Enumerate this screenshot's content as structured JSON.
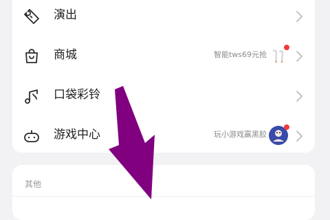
{
  "menu": {
    "items": [
      {
        "label": "演出",
        "icon": "ticket-icon",
        "hint": ""
      },
      {
        "label": "商城",
        "icon": "shopping-bag-icon",
        "hint": "智能tws69元抢"
      },
      {
        "label": "口袋彩铃",
        "icon": "music-note-icon",
        "hint": ""
      },
      {
        "label": "游戏中心",
        "icon": "gamepad-icon",
        "hint": "玩小游戏赢黑胶"
      }
    ]
  },
  "other": {
    "title": "其他"
  },
  "colors": {
    "annotation_arrow": "#800080",
    "badge_dot": "#f23a3a"
  }
}
